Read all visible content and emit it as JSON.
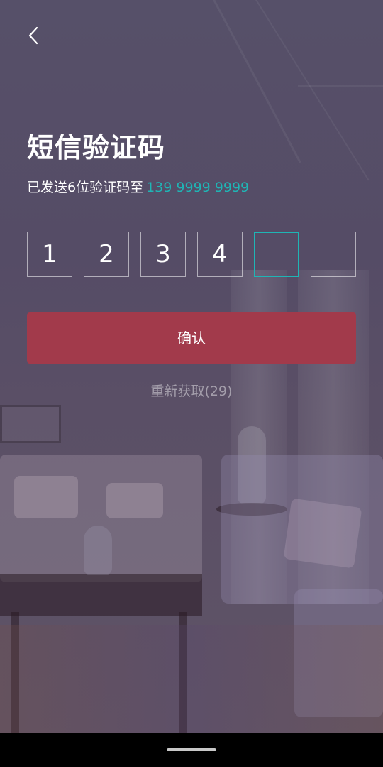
{
  "header": {
    "back_icon": "chevron-left-icon"
  },
  "title": "短信验证码",
  "subtitle": {
    "prefix": "已发送6位验证码至",
    "phone": "139 9999 9999"
  },
  "code": {
    "digits": [
      "1",
      "2",
      "3",
      "4",
      "",
      ""
    ],
    "active_index": 4
  },
  "confirm_label": "确认",
  "resend_label": "重新获取(29)",
  "colors": {
    "accent": "#1fb5b5",
    "confirm_button": "#a23a4b",
    "overlay": "#554c66"
  }
}
